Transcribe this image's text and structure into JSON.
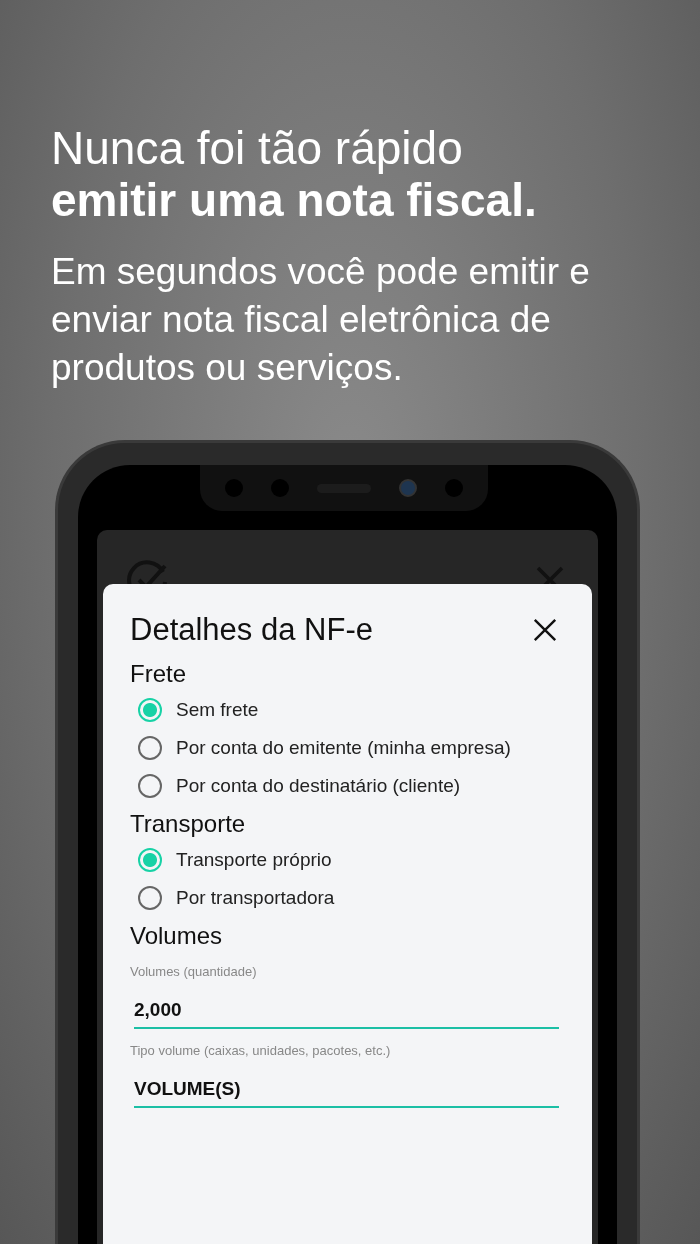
{
  "headline": {
    "light": "Nunca foi tão rápido",
    "bold": "emitir uma nota fiscal."
  },
  "subheadline": "Em segundos você pode emitir e enviar nota fiscal eletrônica de produtos ou serviços.",
  "sheet": {
    "title": "Detalhes da NF-e",
    "sections": [
      {
        "kind": "radio",
        "title": "Frete",
        "options": [
          {
            "label": "Sem frete",
            "selected": true
          },
          {
            "label": "Por conta do emitente (minha empresa)",
            "selected": false
          },
          {
            "label": "Por conta do destinatário (cliente)",
            "selected": false
          }
        ]
      },
      {
        "kind": "radio",
        "title": "Transporte",
        "options": [
          {
            "label": "Transporte próprio",
            "selected": true
          },
          {
            "label": "Por transportadora",
            "selected": false
          }
        ]
      },
      {
        "kind": "fields",
        "title": "Volumes",
        "fields": [
          {
            "label": "Volumes (quantidade)",
            "value": "2,000"
          },
          {
            "label": "Tipo volume (caixas, unidades, pacotes, etc.)",
            "value": "VOLUME(S)"
          }
        ]
      }
    ]
  }
}
